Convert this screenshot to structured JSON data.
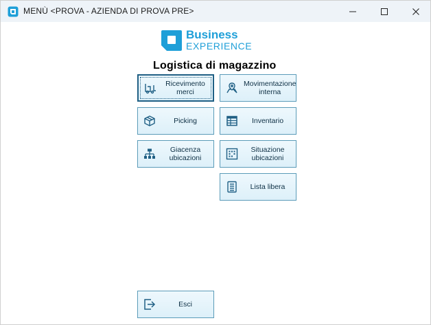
{
  "window": {
    "title": "MENÙ <PROVA - AZIENDA DI PROVA PRE>",
    "minimize_icon": "minimize-icon",
    "maximize_icon": "maximize-icon",
    "close_icon": "close-icon"
  },
  "logo": {
    "line1": "Business",
    "line2": "EXPERIENCE",
    "color": "#1e9fd8"
  },
  "section_title": "Logistica di magazzino",
  "tiles": [
    {
      "label": "Ricevimento merci",
      "icon": "forklift-icon"
    },
    {
      "label": "Movimentazione interna",
      "icon": "map-pin-icon"
    },
    {
      "label": "Picking",
      "icon": "box-icon"
    },
    {
      "label": "Inventario",
      "icon": "table-icon"
    },
    {
      "label": "Giacenza ubicazioni",
      "icon": "hierarchy-icon"
    },
    {
      "label": "Situazione ubicazioni",
      "icon": "dot-grid-icon"
    },
    {
      "label": "Lista libera",
      "icon": "list-icon"
    },
    {
      "label": "Esci",
      "icon": "exit-icon"
    }
  ],
  "colors": {
    "tile_border": "#5a9bb8",
    "tile_bg": "#ddf0f9",
    "icon": "#1f5f84"
  }
}
